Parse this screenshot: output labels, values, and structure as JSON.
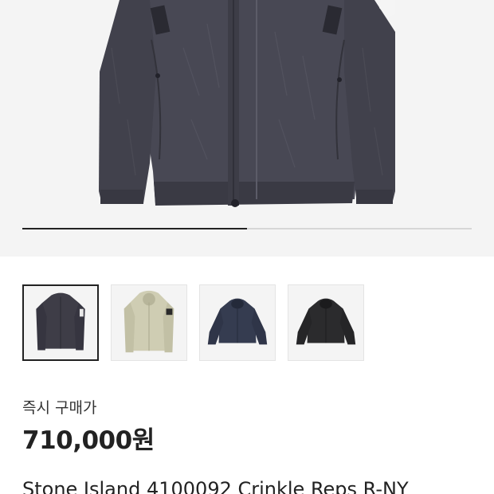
{
  "gallery": {
    "progress_fraction": 0.5,
    "thumbnails": [
      {
        "name": "thumb-dark-grey-jacket",
        "color": "#3e3d47",
        "selected": true
      },
      {
        "name": "thumb-beige-jacket",
        "color": "#c9c8ad",
        "selected": false
      },
      {
        "name": "thumb-navy-jacket",
        "color": "#353c50",
        "selected": false
      },
      {
        "name": "thumb-black-jacket",
        "color": "#2b2b2d",
        "selected": false
      }
    ]
  },
  "price": {
    "label": "즉시 구매가",
    "value": "710,000원"
  },
  "product": {
    "title": "Stone Island 4100092 Crinkle Reps R-NY"
  },
  "colors": {
    "hero_background": "#f4f4f4",
    "jacket_main": "#4a4a55"
  }
}
